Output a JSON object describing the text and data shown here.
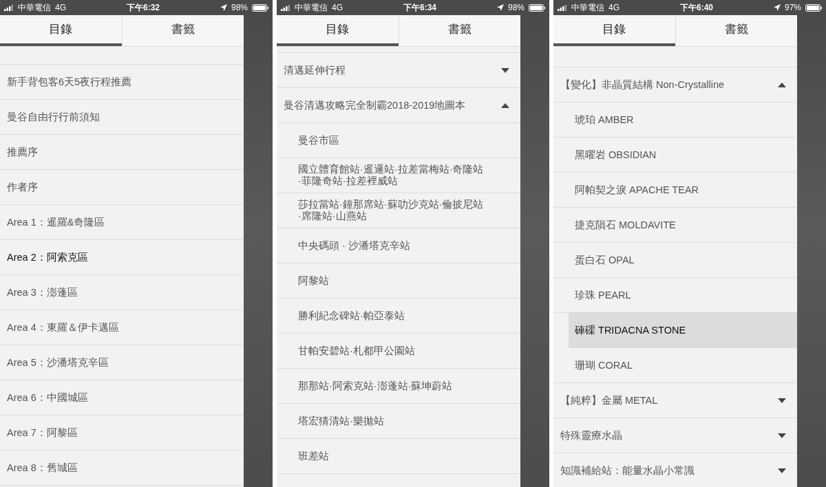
{
  "screens": [
    {
      "status_bar": {
        "carrier": "中華電信",
        "network": "4G",
        "time": "下午6:32",
        "battery": "98%"
      },
      "tabs": [
        {
          "label": "目錄",
          "selected": true
        },
        {
          "label": "書籤",
          "selected": false
        }
      ],
      "items": [
        {
          "label": "新手背包客6天5夜行程推薦",
          "selected": false
        },
        {
          "label": "曼谷自由行行前須知",
          "selected": false
        },
        {
          "label": "推薦序",
          "selected": false
        },
        {
          "label": "作者序",
          "selected": false
        },
        {
          "label": "Area 1：暹羅&奇隆區",
          "selected": false
        },
        {
          "label": "Area 2：阿索克區",
          "selected": true
        },
        {
          "label": "Area 3：澎蓬區",
          "selected": false
        },
        {
          "label": "Area 4：東羅＆伊卡邁區",
          "selected": false
        },
        {
          "label": "Area 5：沙潘塔克辛區",
          "selected": false
        },
        {
          "label": "Area 6：中國城區",
          "selected": false
        },
        {
          "label": "Area 7：阿黎區",
          "selected": false
        },
        {
          "label": "Area 8：舊城區",
          "selected": false
        }
      ]
    },
    {
      "status_bar": {
        "carrier": "中華電信",
        "network": "4G",
        "time": "下午6:34",
        "battery": "98%"
      },
      "tabs": [
        {
          "label": "目錄",
          "selected": true
        },
        {
          "label": "書籤",
          "selected": false
        }
      ],
      "items": [
        {
          "label": "清邁延伸行程",
          "selected": false,
          "expanded": false
        },
        {
          "label": "曼谷清邁攻略完全制霸2018-2019地圖本",
          "selected": false,
          "expanded": true,
          "children": [
            {
              "label": "曼谷市區",
              "selected": false
            },
            {
              "label": "國立體育館站·暹邏站·拉差當梅站·奇隆站·菲隆奇站·拉差裡威站",
              "selected": false
            },
            {
              "label": "莎拉當站·鐘那席站·蘇叻沙克站·倫披尼站·席隆站·山燕站",
              "selected": false
            },
            {
              "label": "中央碼頭 · 沙潘塔克辛站",
              "selected": false
            },
            {
              "label": "阿黎站",
              "selected": false
            },
            {
              "label": "勝利紀念碑站·帕亞泰站",
              "selected": false
            },
            {
              "label": "甘帕安碧站·札都甲公園站",
              "selected": false
            },
            {
              "label": "那那站·阿索克站·澎蓬站·蘇坤蔚站",
              "selected": false
            },
            {
              "label": "塔宏猜清站·樂拋站",
              "selected": false
            },
            {
              "label": "班差站",
              "selected": false
            }
          ]
        }
      ]
    },
    {
      "status_bar": {
        "carrier": "中華電信",
        "network": "4G",
        "time": "下午6:40",
        "battery": "97%"
      },
      "tabs": [
        {
          "label": "目錄",
          "selected": true
        },
        {
          "label": "書籤",
          "selected": false
        }
      ],
      "items": [
        {
          "label": "【變化】非晶質結構 Non-Crystalline",
          "selected": false,
          "expanded": true,
          "children": [
            {
              "label": "琥珀 AMBER",
              "selected": false
            },
            {
              "label": "黑曜岩 OBSIDIAN",
              "selected": false
            },
            {
              "label": "阿帕契之淚 APACHE TEAR",
              "selected": false
            },
            {
              "label": "捷克隕石 MOLDAVITE",
              "selected": false
            },
            {
              "label": "蛋白石 OPAL",
              "selected": false
            },
            {
              "label": "珍珠 PEARL",
              "selected": false
            },
            {
              "label": "硨磲 TRIDACNA STONE",
              "selected": true
            },
            {
              "label": "珊瑚 CORAL",
              "selected": false
            }
          ]
        },
        {
          "label": "【純粹】金屬 METAL",
          "selected": false,
          "expanded": false
        },
        {
          "label": "特殊靈療水晶",
          "selected": false,
          "expanded": false
        },
        {
          "label": "知識補給站：能量水晶小常識",
          "selected": false,
          "expanded": false
        }
      ]
    }
  ]
}
